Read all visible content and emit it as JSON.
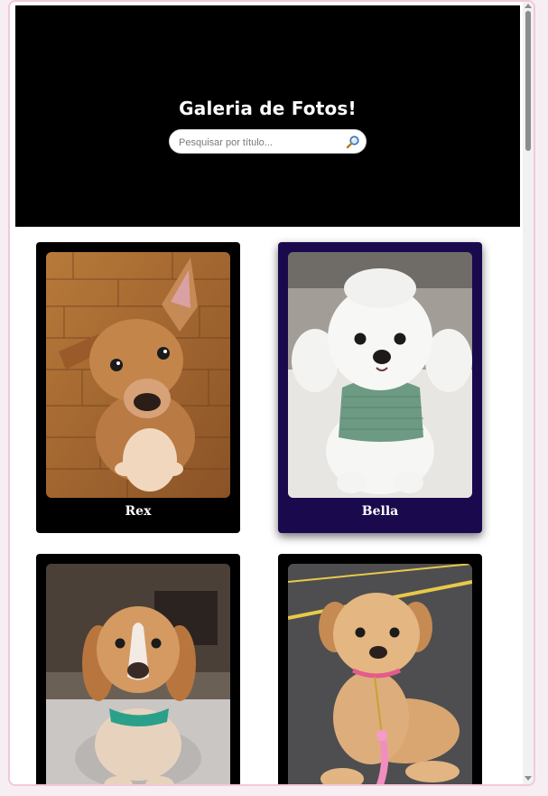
{
  "header": {
    "title": "Galeria de Fotos!",
    "search_placeholder": "Pesquisar por título..."
  },
  "cards": [
    {
      "label": "Rex",
      "color": "#000000",
      "selected": false
    },
    {
      "label": "Bella",
      "color": "#1a0a4d",
      "selected": true
    },
    {
      "label": "",
      "color": "#000000",
      "selected": false
    },
    {
      "label": "",
      "color": "#000000",
      "selected": false
    }
  ],
  "colors": {
    "header_bg": "#000000",
    "card_bg": "#000000",
    "selected_card_bg": "#1a0a4d",
    "page_border": "#f2c9d8"
  }
}
